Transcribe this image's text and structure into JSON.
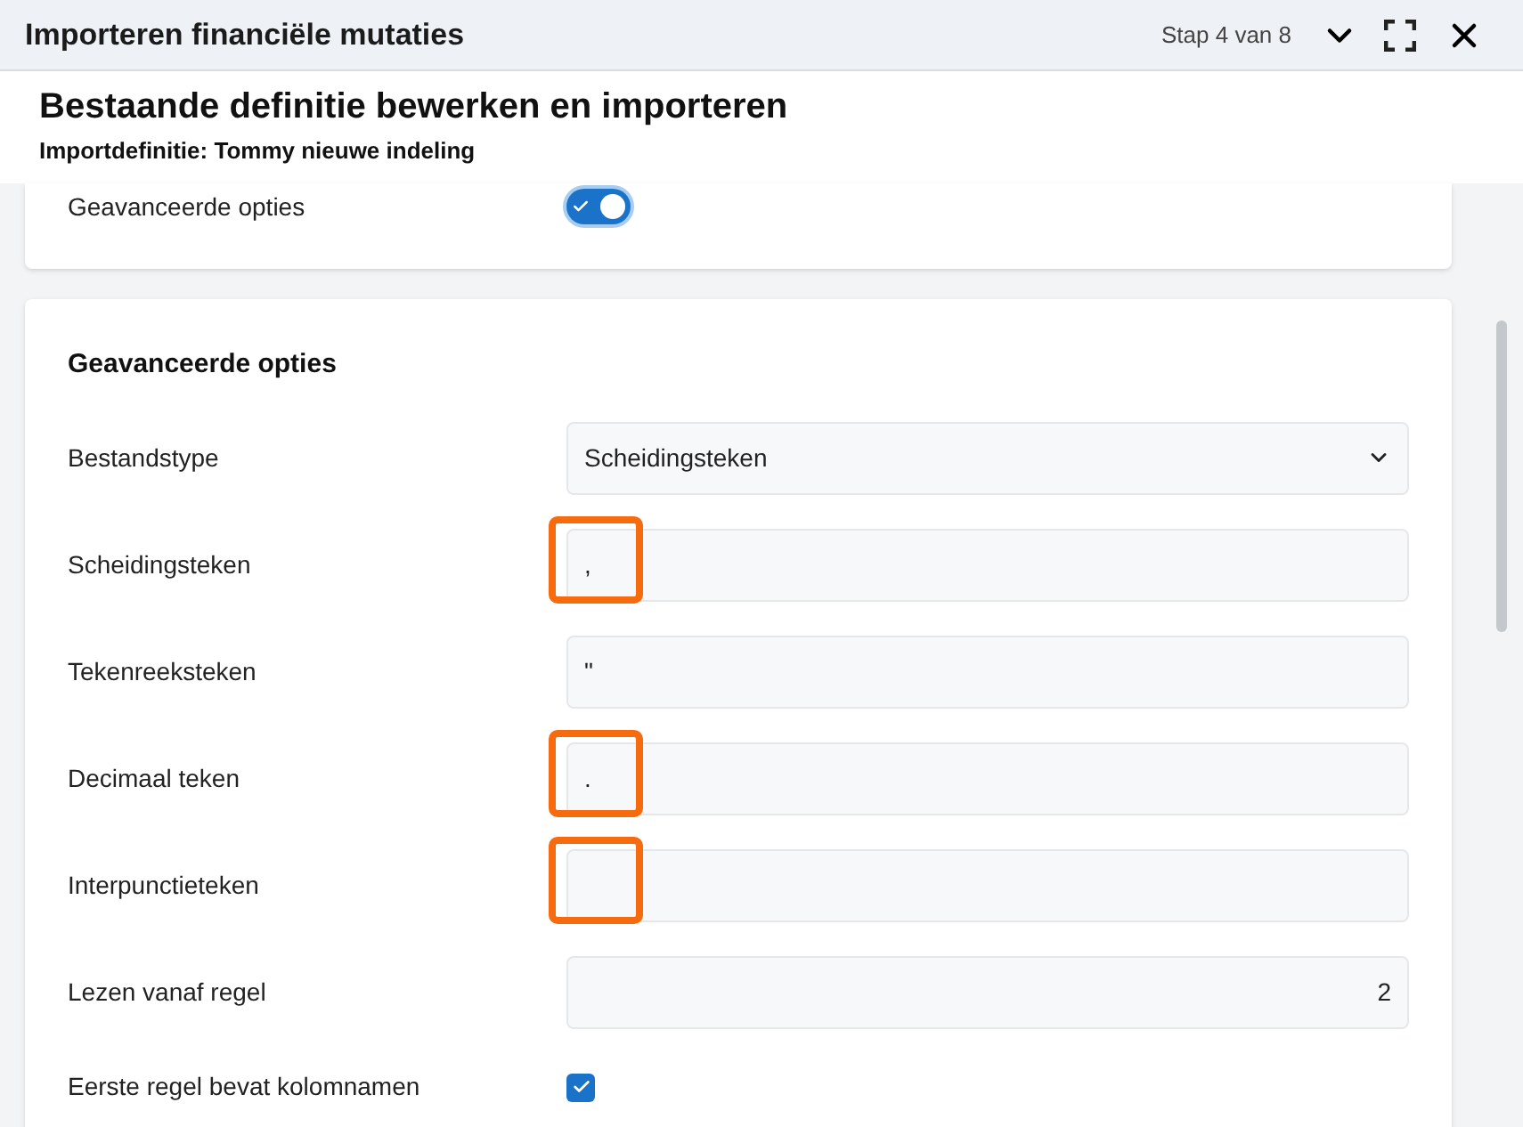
{
  "window": {
    "title": "Importeren financiële mutaties",
    "step": "Stap 4 van 8"
  },
  "header": {
    "title": "Bestaande definitie bewerken en importeren",
    "subtitle": "Importdefinitie: Tommy nieuwe indeling"
  },
  "toggle_row": {
    "label": "Geavanceerde opties",
    "on": true
  },
  "section": {
    "title": "Geavanceerde opties",
    "fields": [
      {
        "kind": "select",
        "label": "Bestandstype",
        "value": "Scheidingsteken",
        "highlighted": false
      },
      {
        "kind": "text",
        "label": "Scheidingsteken",
        "value": ",",
        "highlighted": true
      },
      {
        "kind": "text",
        "label": "Tekenreeksteken",
        "value": "\"",
        "highlighted": false
      },
      {
        "kind": "text",
        "label": "Decimaal teken",
        "value": ".",
        "highlighted": true
      },
      {
        "kind": "text",
        "label": "Interpunctieteken",
        "highlighted": true
      },
      {
        "kind": "number",
        "label": "Lezen vanaf regel",
        "value": "2",
        "highlighted": false
      },
      {
        "kind": "checkbox",
        "label": "Eerste regel bevat kolomnamen",
        "checked": true
      }
    ]
  }
}
